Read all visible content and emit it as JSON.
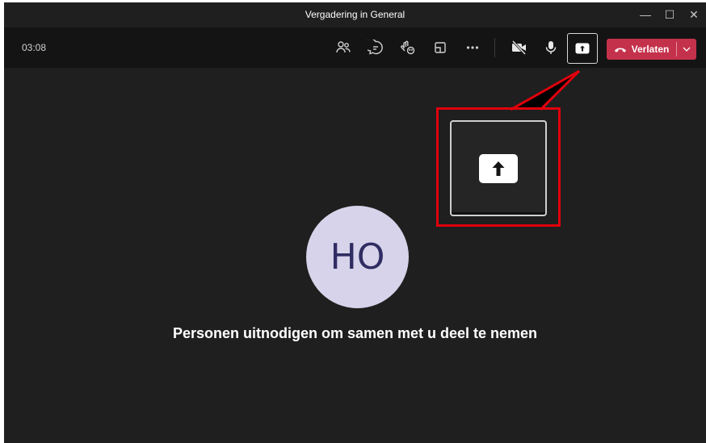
{
  "window": {
    "title": "Vergadering in General",
    "controls": {
      "minimize": "—",
      "maximize": "☐",
      "close": "✕"
    }
  },
  "toolbar": {
    "timer": "03:08",
    "icons": [
      "participants-icon",
      "chat-icon",
      "reactions-icon",
      "rooms-icon",
      "more-options-icon",
      "camera-off-icon",
      "microphone-icon",
      "share-screen-icon"
    ],
    "leave_label": "Verlaten",
    "leave_color": "#c4314b"
  },
  "stage": {
    "avatar_initials": "HO",
    "avatar_bg": "#d6d3ea",
    "avatar_fg": "#302d63",
    "invite_text": "Personen uitnodigen om samen met u deel te nemen"
  },
  "callout": {
    "highlight_color": "#e0000c",
    "icon": "share-screen-icon"
  }
}
